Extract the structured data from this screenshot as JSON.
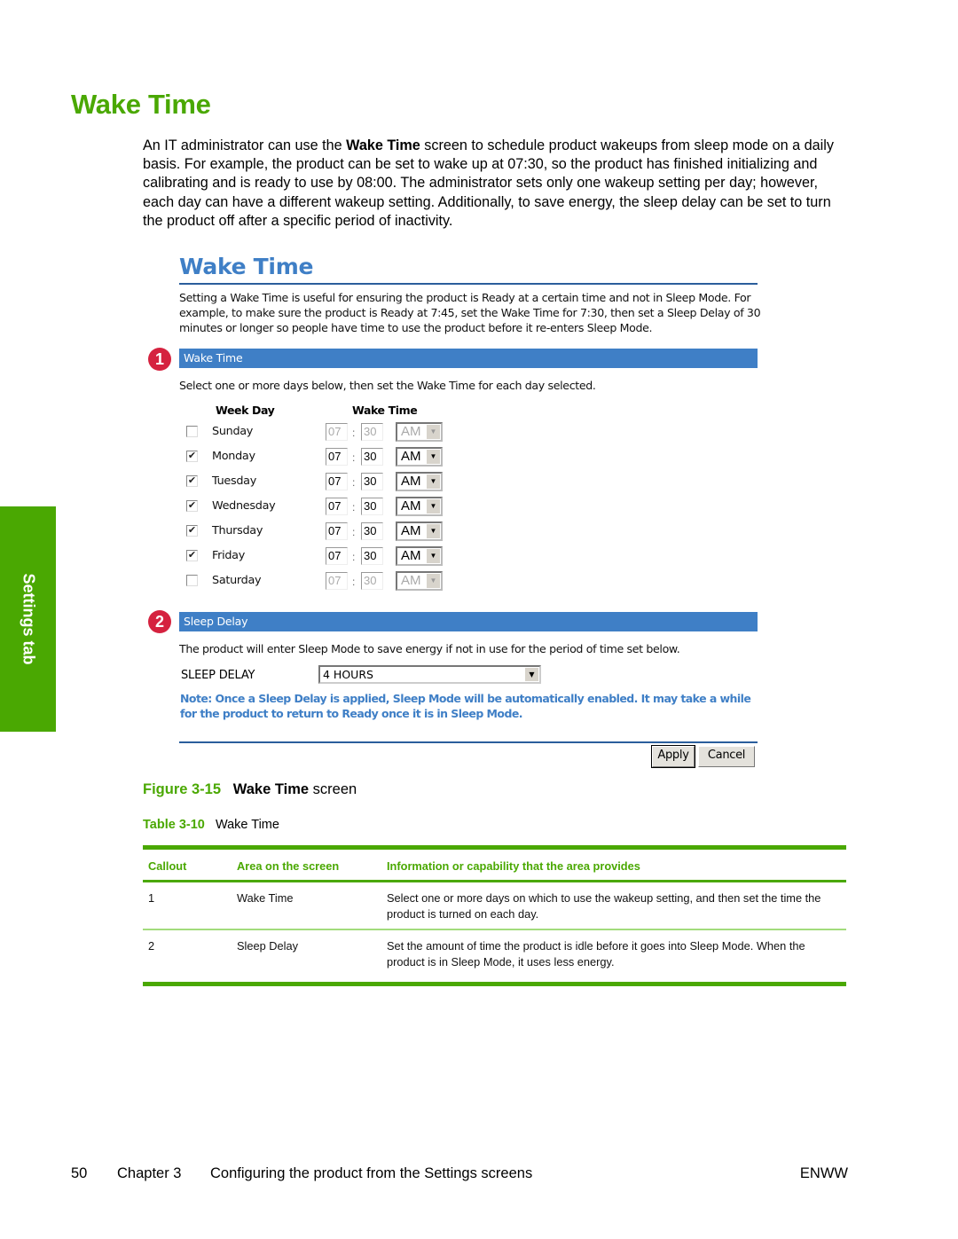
{
  "page": {
    "title": "Wake Time",
    "intro": {
      "before": "An IT administrator can use the ",
      "bold": "Wake Time",
      "after": " screen to schedule product wakeups from sleep mode on a daily basis. For example, the product can be set to wake up at 07:30, so the product has finished initializing and calibrating and is ready to use by 08:00. The administrator sets only one wakeup setting per day; however, each day can have a different wakeup setting. Additionally, to save energy, the sleep delay can be set to turn the product off after a specific period of inactivity."
    },
    "side_tab": "Settings tab"
  },
  "screenshot": {
    "title": "Wake Time",
    "description": "Setting a Wake Time is useful for ensuring the product is Ready at a certain time and not in Sleep Mode. For example, to make sure the product is Ready at 7:45, set the Wake Time for 7:30, then set a Sleep Delay of 30 minutes or longer so people have time to use the product before it re-enters Sleep Mode.",
    "wake_section": {
      "callout": "1",
      "header": "Wake Time",
      "instruction": "Select one or more days below, then set the Wake Time for each day selected.",
      "col_weekday": "Week Day",
      "col_waketime": "Wake Time",
      "colon": ":",
      "days": [
        {
          "name": "Sunday",
          "checked": false,
          "check_mark": "",
          "hour": "07",
          "minute": "30",
          "ampm": "AM"
        },
        {
          "name": "Monday",
          "checked": true,
          "check_mark": "✔",
          "hour": "07",
          "minute": "30",
          "ampm": "AM"
        },
        {
          "name": "Tuesday",
          "checked": true,
          "check_mark": "✔",
          "hour": "07",
          "minute": "30",
          "ampm": "AM"
        },
        {
          "name": "Wednesday",
          "checked": true,
          "check_mark": "✔",
          "hour": "07",
          "minute": "30",
          "ampm": "AM"
        },
        {
          "name": "Thursday",
          "checked": true,
          "check_mark": "✔",
          "hour": "07",
          "minute": "30",
          "ampm": "AM"
        },
        {
          "name": "Friday",
          "checked": true,
          "check_mark": "✔",
          "hour": "07",
          "minute": "30",
          "ampm": "AM"
        },
        {
          "name": "Saturday",
          "checked": false,
          "check_mark": "",
          "hour": "07",
          "minute": "30",
          "ampm": "AM"
        }
      ]
    },
    "sleep_section": {
      "callout": "2",
      "header": "Sleep Delay",
      "instruction": "The product will enter Sleep Mode to save energy if not in use for the period of time set below.",
      "label": "SLEEP DELAY",
      "selected": "4 HOURS",
      "note": "Note: Once a Sleep Delay is applied, Sleep Mode will be automatically enabled. It may take a while for the product to return to Ready once it is in Sleep Mode."
    },
    "buttons": {
      "apply": "Apply",
      "cancel": "Cancel"
    },
    "dropdown_arrow": "▼"
  },
  "figure_caption": {
    "label": "Figure 3-15",
    "bold": "Wake Time",
    "rest": " screen"
  },
  "table_caption": {
    "label": "Table 3-10",
    "text": "Wake Time"
  },
  "table": {
    "headers": [
      "Callout",
      "Area on the screen",
      "Information or capability that the area provides"
    ],
    "rows": [
      [
        "1",
        "Wake Time",
        "Select one or more days on which to use the wakeup setting, and then set the time the product is turned on each day."
      ],
      [
        "2",
        "Sleep Delay",
        "Set the amount of time the product is idle before it goes into Sleep Mode. When the product is in Sleep Mode, it uses less energy."
      ]
    ]
  },
  "footer": {
    "page_number": "50",
    "chapter": "Chapter 3",
    "chapter_title": "Configuring the product from the Settings screens",
    "right": "ENWW"
  }
}
